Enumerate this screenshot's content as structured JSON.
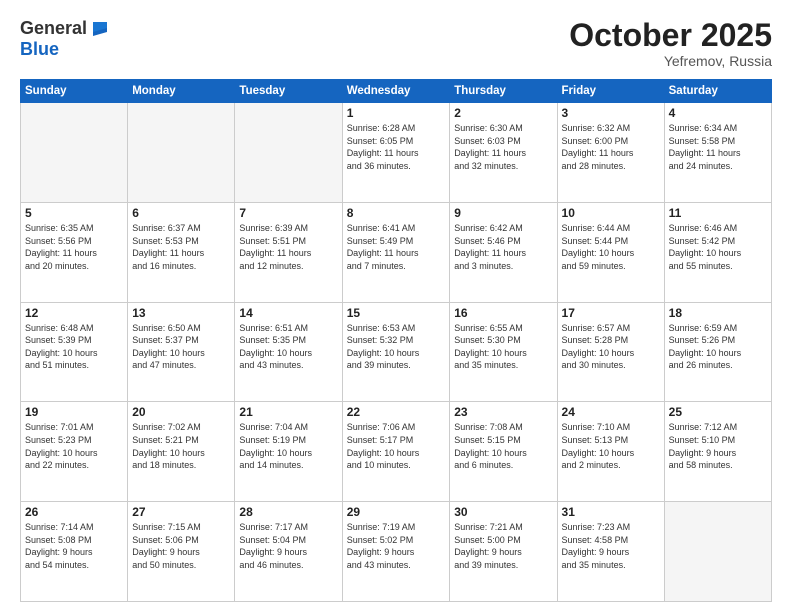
{
  "header": {
    "logo_general": "General",
    "logo_blue": "Blue",
    "title": "October 2025",
    "subtitle": "Yefremov, Russia"
  },
  "weekdays": [
    "Sunday",
    "Monday",
    "Tuesday",
    "Wednesday",
    "Thursday",
    "Friday",
    "Saturday"
  ],
  "weeks": [
    [
      {
        "day": "",
        "info": ""
      },
      {
        "day": "",
        "info": ""
      },
      {
        "day": "",
        "info": ""
      },
      {
        "day": "1",
        "info": "Sunrise: 6:28 AM\nSunset: 6:05 PM\nDaylight: 11 hours\nand 36 minutes."
      },
      {
        "day": "2",
        "info": "Sunrise: 6:30 AM\nSunset: 6:03 PM\nDaylight: 11 hours\nand 32 minutes."
      },
      {
        "day": "3",
        "info": "Sunrise: 6:32 AM\nSunset: 6:00 PM\nDaylight: 11 hours\nand 28 minutes."
      },
      {
        "day": "4",
        "info": "Sunrise: 6:34 AM\nSunset: 5:58 PM\nDaylight: 11 hours\nand 24 minutes."
      }
    ],
    [
      {
        "day": "5",
        "info": "Sunrise: 6:35 AM\nSunset: 5:56 PM\nDaylight: 11 hours\nand 20 minutes."
      },
      {
        "day": "6",
        "info": "Sunrise: 6:37 AM\nSunset: 5:53 PM\nDaylight: 11 hours\nand 16 minutes."
      },
      {
        "day": "7",
        "info": "Sunrise: 6:39 AM\nSunset: 5:51 PM\nDaylight: 11 hours\nand 12 minutes."
      },
      {
        "day": "8",
        "info": "Sunrise: 6:41 AM\nSunset: 5:49 PM\nDaylight: 11 hours\nand 7 minutes."
      },
      {
        "day": "9",
        "info": "Sunrise: 6:42 AM\nSunset: 5:46 PM\nDaylight: 11 hours\nand 3 minutes."
      },
      {
        "day": "10",
        "info": "Sunrise: 6:44 AM\nSunset: 5:44 PM\nDaylight: 10 hours\nand 59 minutes."
      },
      {
        "day": "11",
        "info": "Sunrise: 6:46 AM\nSunset: 5:42 PM\nDaylight: 10 hours\nand 55 minutes."
      }
    ],
    [
      {
        "day": "12",
        "info": "Sunrise: 6:48 AM\nSunset: 5:39 PM\nDaylight: 10 hours\nand 51 minutes."
      },
      {
        "day": "13",
        "info": "Sunrise: 6:50 AM\nSunset: 5:37 PM\nDaylight: 10 hours\nand 47 minutes."
      },
      {
        "day": "14",
        "info": "Sunrise: 6:51 AM\nSunset: 5:35 PM\nDaylight: 10 hours\nand 43 minutes."
      },
      {
        "day": "15",
        "info": "Sunrise: 6:53 AM\nSunset: 5:32 PM\nDaylight: 10 hours\nand 39 minutes."
      },
      {
        "day": "16",
        "info": "Sunrise: 6:55 AM\nSunset: 5:30 PM\nDaylight: 10 hours\nand 35 minutes."
      },
      {
        "day": "17",
        "info": "Sunrise: 6:57 AM\nSunset: 5:28 PM\nDaylight: 10 hours\nand 30 minutes."
      },
      {
        "day": "18",
        "info": "Sunrise: 6:59 AM\nSunset: 5:26 PM\nDaylight: 10 hours\nand 26 minutes."
      }
    ],
    [
      {
        "day": "19",
        "info": "Sunrise: 7:01 AM\nSunset: 5:23 PM\nDaylight: 10 hours\nand 22 minutes."
      },
      {
        "day": "20",
        "info": "Sunrise: 7:02 AM\nSunset: 5:21 PM\nDaylight: 10 hours\nand 18 minutes."
      },
      {
        "day": "21",
        "info": "Sunrise: 7:04 AM\nSunset: 5:19 PM\nDaylight: 10 hours\nand 14 minutes."
      },
      {
        "day": "22",
        "info": "Sunrise: 7:06 AM\nSunset: 5:17 PM\nDaylight: 10 hours\nand 10 minutes."
      },
      {
        "day": "23",
        "info": "Sunrise: 7:08 AM\nSunset: 5:15 PM\nDaylight: 10 hours\nand 6 minutes."
      },
      {
        "day": "24",
        "info": "Sunrise: 7:10 AM\nSunset: 5:13 PM\nDaylight: 10 hours\nand 2 minutes."
      },
      {
        "day": "25",
        "info": "Sunrise: 7:12 AM\nSunset: 5:10 PM\nDaylight: 9 hours\nand 58 minutes."
      }
    ],
    [
      {
        "day": "26",
        "info": "Sunrise: 7:14 AM\nSunset: 5:08 PM\nDaylight: 9 hours\nand 54 minutes."
      },
      {
        "day": "27",
        "info": "Sunrise: 7:15 AM\nSunset: 5:06 PM\nDaylight: 9 hours\nand 50 minutes."
      },
      {
        "day": "28",
        "info": "Sunrise: 7:17 AM\nSunset: 5:04 PM\nDaylight: 9 hours\nand 46 minutes."
      },
      {
        "day": "29",
        "info": "Sunrise: 7:19 AM\nSunset: 5:02 PM\nDaylight: 9 hours\nand 43 minutes."
      },
      {
        "day": "30",
        "info": "Sunrise: 7:21 AM\nSunset: 5:00 PM\nDaylight: 9 hours\nand 39 minutes."
      },
      {
        "day": "31",
        "info": "Sunrise: 7:23 AM\nSunset: 4:58 PM\nDaylight: 9 hours\nand 35 minutes."
      },
      {
        "day": "",
        "info": ""
      }
    ]
  ]
}
